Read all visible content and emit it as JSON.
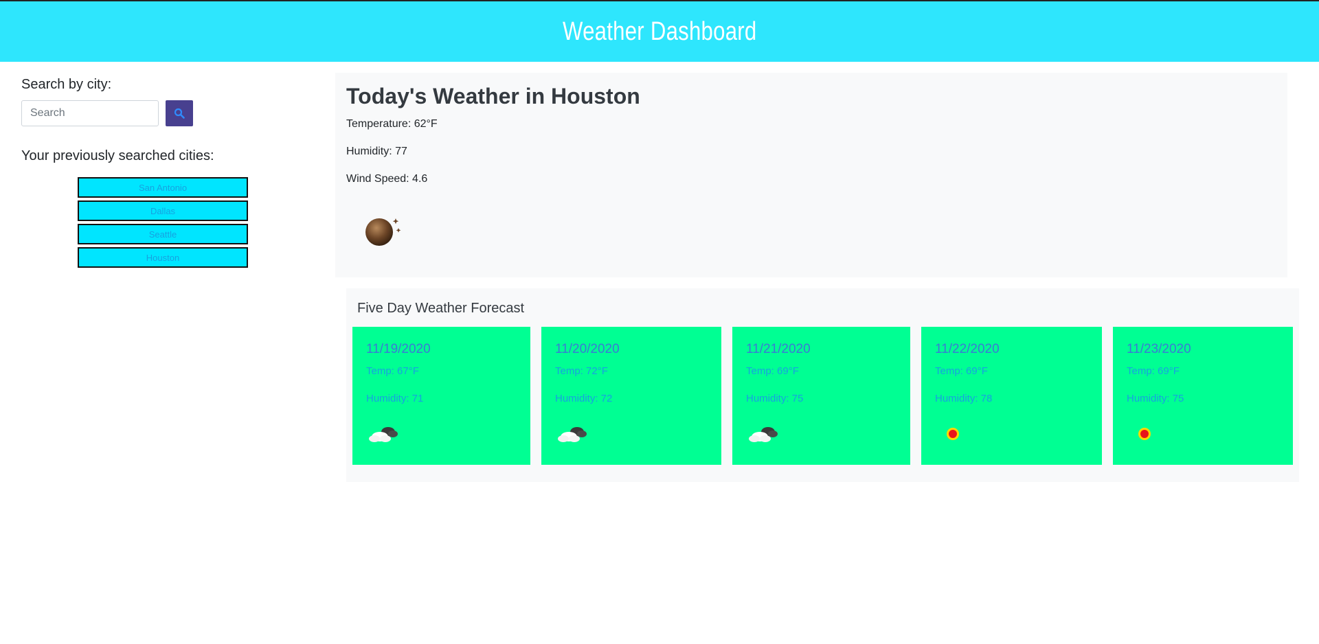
{
  "header": {
    "title": "Weather Dashboard"
  },
  "sidebar": {
    "search_label": "Search by city:",
    "search_placeholder": "Search",
    "previous_label": "Your previously searched cities:",
    "cities": [
      "San Antonio",
      "Dallas",
      "Seattle",
      "Houston"
    ]
  },
  "today": {
    "title": "Today's Weather in Houston",
    "temperature": "Temperature: 62°F",
    "humidity": "Humidity: 77",
    "wind": "Wind Speed: 4.6",
    "icon": "night-clear-icon"
  },
  "forecast": {
    "title": "Five Day Weather Forecast",
    "days": [
      {
        "date": "11/19/2020",
        "temp": "Temp: 67°F",
        "humidity": "Humidity: 71",
        "icon": "partly-cloudy-icon"
      },
      {
        "date": "11/20/2020",
        "temp": "Temp: 72°F",
        "humidity": "Humidity: 72",
        "icon": "partly-cloudy-icon"
      },
      {
        "date": "11/21/2020",
        "temp": "Temp: 69°F",
        "humidity": "Humidity: 75",
        "icon": "partly-cloudy-icon"
      },
      {
        "date": "11/22/2020",
        "temp": "Temp: 69°F",
        "humidity": "Humidity: 78",
        "icon": "sun-icon"
      },
      {
        "date": "11/23/2020",
        "temp": "Temp: 69°F",
        "humidity": "Humidity: 75",
        "icon": "sun-icon"
      }
    ]
  },
  "colors": {
    "header": "#2ee6fd",
    "city_button": "#00e5ff",
    "search_button": "#48408f",
    "forecast_card": "#00ff93",
    "panel": "#f8f9fa"
  }
}
